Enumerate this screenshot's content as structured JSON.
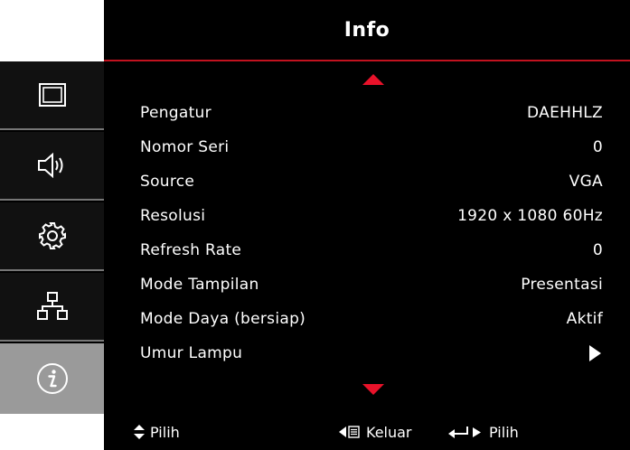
{
  "header": {
    "title": "Info"
  },
  "sidebar": {
    "items": [
      {
        "icon": "display-icon",
        "active": false
      },
      {
        "icon": "speaker-icon",
        "active": false
      },
      {
        "icon": "gear-icon",
        "active": false
      },
      {
        "icon": "network-icon",
        "active": false
      },
      {
        "icon": "info-icon",
        "active": true
      }
    ]
  },
  "info": {
    "rows": [
      {
        "label": "Pengatur",
        "value": "DAEHHLZ"
      },
      {
        "label": "Nomor Seri",
        "value": "0"
      },
      {
        "label": "Source",
        "value": "VGA"
      },
      {
        "label": "Resolusi",
        "value": "1920 x 1080 60Hz"
      },
      {
        "label": "Refresh Rate",
        "value": "0"
      },
      {
        "label": "Mode Tampilan",
        "value": "Presentasi"
      },
      {
        "label": "Mode Daya (bersiap)",
        "value": "Aktif"
      },
      {
        "label": "Umur Lampu",
        "value": ""
      }
    ]
  },
  "footer": {
    "select_label": "Pilih",
    "exit_label": "Keluar",
    "enter_label": "Pilih"
  },
  "colors": {
    "accent": "#e8122a",
    "rule": "#c1121f",
    "background": "#000000",
    "active_tab": "#9a9a9a",
    "text": "#ffffff"
  }
}
